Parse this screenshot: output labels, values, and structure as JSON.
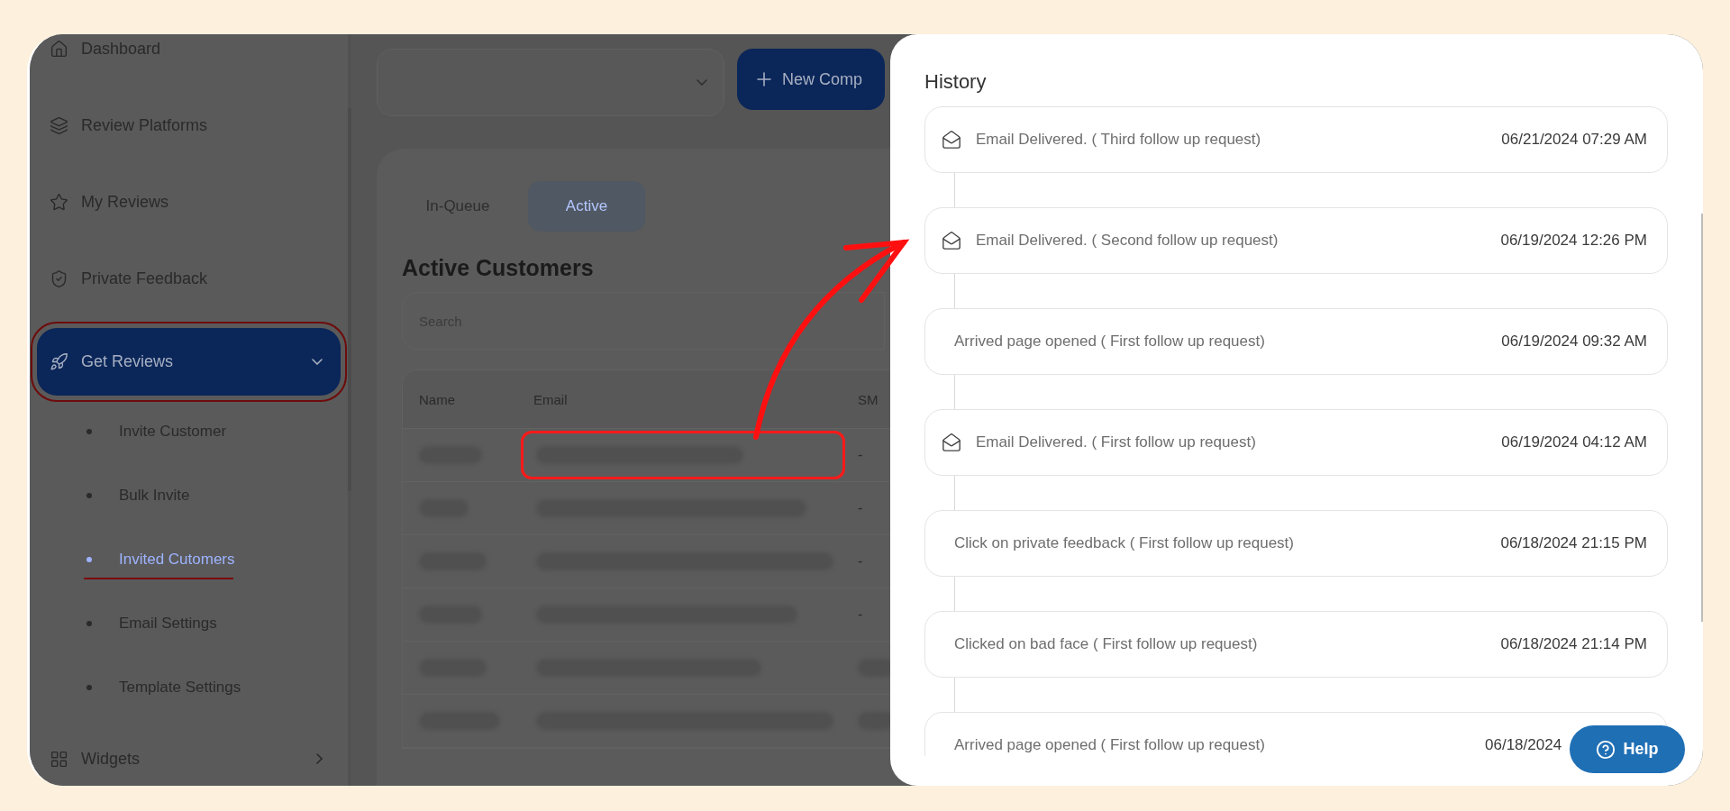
{
  "sidebar": {
    "items": [
      {
        "kind": "home",
        "label": "Dashboard"
      },
      {
        "kind": "layers",
        "label": "Review Platforms"
      },
      {
        "kind": "star",
        "label": "My Reviews"
      },
      {
        "kind": "shield",
        "label": "Private Feedback"
      },
      {
        "kind": "rocket",
        "label": "Get Reviews",
        "selected": true,
        "expanded": true,
        "highlighted": true,
        "children": [
          {
            "label": "Invite Customer",
            "selected": false,
            "underlined": false
          },
          {
            "label": "Bulk Invite",
            "selected": false,
            "underlined": false
          },
          {
            "label": "Invited Cutomers",
            "selected": true,
            "underlined": true
          },
          {
            "label": "Email Settings",
            "selected": false,
            "underlined": false
          },
          {
            "label": "Template Settings",
            "selected": false,
            "underlined": false
          }
        ]
      },
      {
        "kind": "grid",
        "label": "Widgets",
        "selected": false,
        "expanded": false
      }
    ]
  },
  "toolbar": {
    "new_button": {
      "label": "New Comp"
    }
  },
  "tabs": [
    {
      "label": "In-Queue",
      "selected": false
    },
    {
      "label": "Active",
      "selected": true
    }
  ],
  "heading": "Active Customers",
  "search": {
    "placeholder": "Search"
  },
  "table": {
    "columns": [
      "Name",
      "Email",
      "SM"
    ],
    "rows": [
      {
        "sm": "-",
        "highlighted": true
      },
      {
        "sm": "-",
        "highlighted": false
      },
      {
        "sm": "-",
        "highlighted": false
      },
      {
        "sm": "-",
        "highlighted": false
      },
      {
        "highlighted": false
      },
      {
        "highlighted": false
      }
    ]
  },
  "history": {
    "title": "History",
    "entries": [
      {
        "kind": "email",
        "text": "Email Delivered. ( Third follow up request)",
        "time": "06/21/2024 07:29 AM"
      },
      {
        "kind": "email",
        "text": "Email Delivered. ( Second follow up request)",
        "time": "06/19/2024 12:26 PM"
      },
      {
        "kind": "event",
        "text": "Arrived page opened ( First follow up request)",
        "time": "06/19/2024 09:32 AM"
      },
      {
        "kind": "email",
        "text": "Email Delivered. ( First follow up request)",
        "time": "06/19/2024 04:12 AM"
      },
      {
        "kind": "event",
        "text": "Click on private feedback ( First follow up request)",
        "time": "06/18/2024 21:15 PM"
      },
      {
        "kind": "event",
        "text": "Clicked on bad face ( First follow up request)",
        "time": "06/18/2024 21:14 PM"
      },
      {
        "kind": "event",
        "text": "Arrived page opened ( First follow up request)",
        "time": "06/18/2024"
      }
    ]
  },
  "help_button": {
    "label": "Help"
  }
}
